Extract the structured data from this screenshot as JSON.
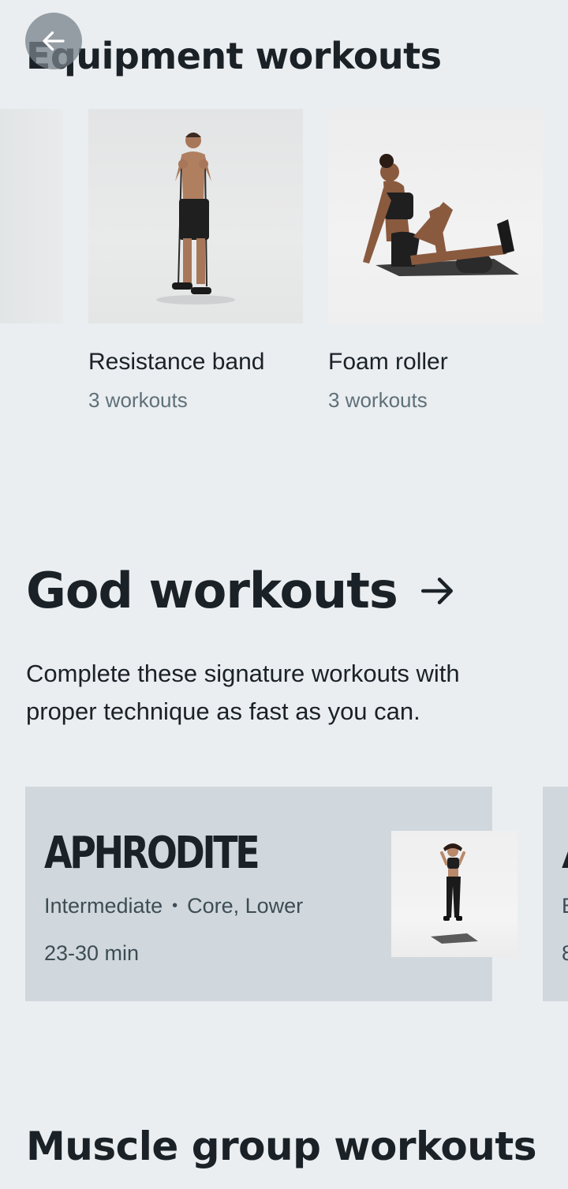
{
  "nav": {
    "back_icon": "arrow-left-icon"
  },
  "equipment": {
    "title": "Equipment workouts",
    "items": [
      {
        "name": "Resistance band",
        "count": "3 workouts"
      },
      {
        "name": "Foam roller",
        "count": "3 workouts"
      }
    ]
  },
  "god": {
    "title": "God workouts",
    "arrow_icon": "arrow-right-icon",
    "description": "Complete these signature workouts with proper technique as fast as you can.",
    "cards": [
      {
        "name": "APHRODITE",
        "level": "Intermediate",
        "focus": "Core, Lower",
        "duration": "23-30 min"
      },
      {
        "name": "A",
        "level": "B",
        "duration": "8"
      }
    ]
  },
  "muscle": {
    "title": "Muscle group workouts"
  },
  "colors": {
    "background": "#eaeef1",
    "card": "#d0d8de",
    "text": "#1b2227",
    "muted": "#5f7079"
  }
}
